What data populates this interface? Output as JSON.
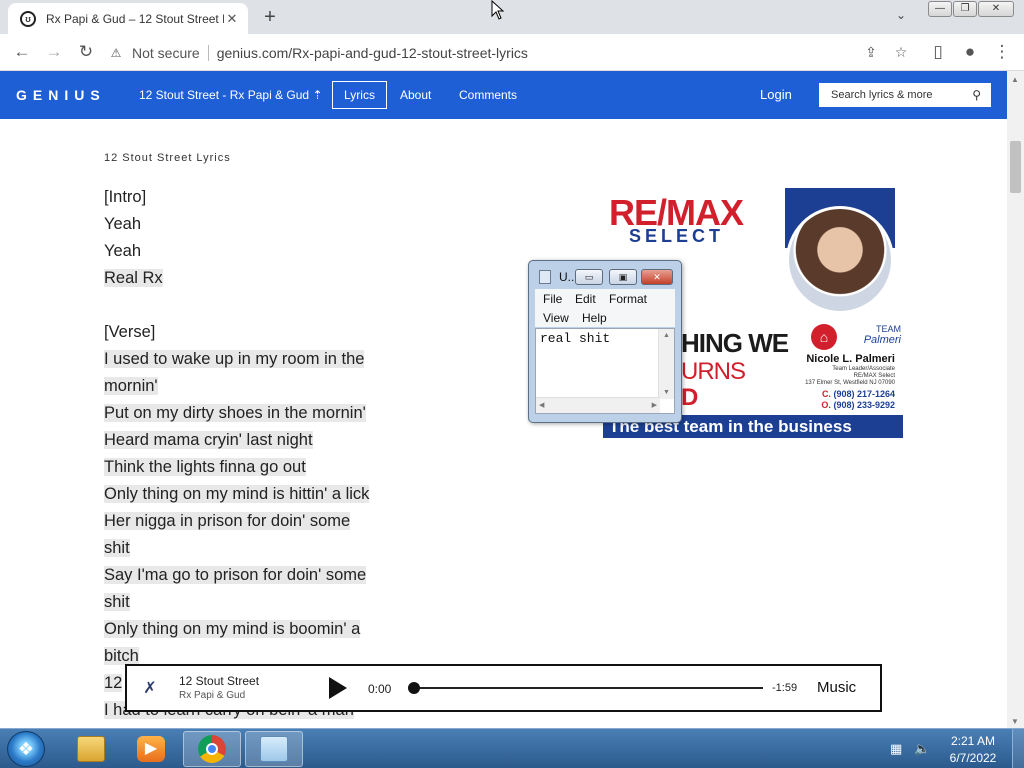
{
  "browser": {
    "tab_title": "Rx Papi & Gud – 12 Stout Street L",
    "tab_close": "✕",
    "new_tab": "+",
    "tab_menu": "⌄",
    "security_label": "Not secure",
    "url": "genius.com/Rx-papi-and-gud-12-stout-street-lyrics",
    "back": "←",
    "forward": "→",
    "reload": "↻",
    "share": "⇪",
    "star": "☆",
    "sidepanel": "▯",
    "profile": "●",
    "kebab": "⋮",
    "win_min": "—",
    "win_max": "❐",
    "win_close": "✕"
  },
  "genius": {
    "logo": "GENIUS",
    "song": "12 Stout Street - Rx Papi & Gud",
    "song_arrow": "⇡",
    "nav": {
      "lyrics": "Lyrics",
      "about": "About",
      "comments": "Comments"
    },
    "login": "Login",
    "search_placeholder": "Search lyrics & more",
    "accent": "#1f5fd6"
  },
  "lyrics": {
    "heading": "12 Stout Street Lyrics",
    "lines": [
      "[Intro]",
      "Yeah",
      "Yeah",
      "Real Rx",
      "",
      "[Verse]",
      "I used to wake up in my room in the",
      "mornin'",
      "Put on my dirty shoes in the mornin'",
      "Heard mama cryin' last night",
      "Think the lights finna go out",
      "Only thing on my mind is hittin' a lick",
      "Her nigga in prison for doin' some",
      "shit",
      "Say I'ma go to prison for doin' some",
      "shit",
      "Only thing on my mind is boomin' a",
      "bitch",
      "12",
      "I had to learn carry on bein' a man"
    ]
  },
  "ad": {
    "brand": "RE/MAX",
    "sub": "SELECT",
    "headline1": "HING WE",
    "headline2": "URNS",
    "headline3": "D",
    "team_label": "TEAM",
    "team_name": "Palmeri",
    "agent_name": "Nicole L. Palmeri",
    "agent_title": "Team Leader/Associate",
    "office": "RE/MAX Select",
    "address": "137 Elmer St, Westfield NJ 07090",
    "phone_c_label": "C.",
    "phone_c": "(908) 217-1264",
    "phone_o_label": "O.",
    "phone_o": "(908) 233-9292",
    "tagline": "The best team in the business"
  },
  "notepad": {
    "title": "U..",
    "menu": {
      "file": "File",
      "edit": "Edit",
      "format": "Format",
      "view": "View",
      "help": "Help"
    },
    "content": "real shit",
    "min": "▭",
    "max": "▣",
    "close": "✕"
  },
  "player": {
    "title": "12 Stout Street",
    "artist": "Rx Papi & Gud",
    "current_time": "0:00",
    "remaining": "-1:59",
    "brand": "Music",
    "progress": 0
  },
  "taskbar": {
    "start": "❖",
    "time": "2:21 AM",
    "date": "6/7/2022"
  }
}
